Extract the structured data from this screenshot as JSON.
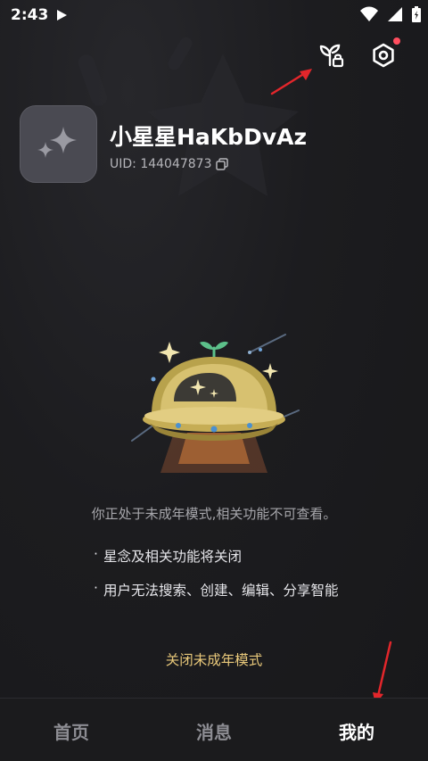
{
  "status_bar": {
    "time": "2:43"
  },
  "profile": {
    "username": "小星星HaKbDvAz",
    "uid": "UID: 144047873"
  },
  "notice": {
    "text": "你正处于未成年模式,相关功能不可查看。",
    "bullets": [
      "星念及相关功能将关闭",
      "用户无法搜索、创建、编辑、分享智能"
    ],
    "close_link": "关闭未成年模式"
  },
  "bottom_nav": {
    "items": [
      {
        "label": "首页"
      },
      {
        "label": "消息"
      },
      {
        "label": "我的"
      }
    ],
    "active_index": 2
  },
  "colors": {
    "background": "#1b1b1d",
    "accent_gold": "#e8c87a",
    "annotation_arrow": "#e3262b",
    "badge_red": "#ff4d5e"
  },
  "icons": [
    "play-icon",
    "wifi-icon",
    "signal-icon",
    "battery-icon",
    "plant-lock-icon",
    "settings-icon",
    "copy-icon",
    "sparkle-icon",
    "ufo-illustration"
  ]
}
